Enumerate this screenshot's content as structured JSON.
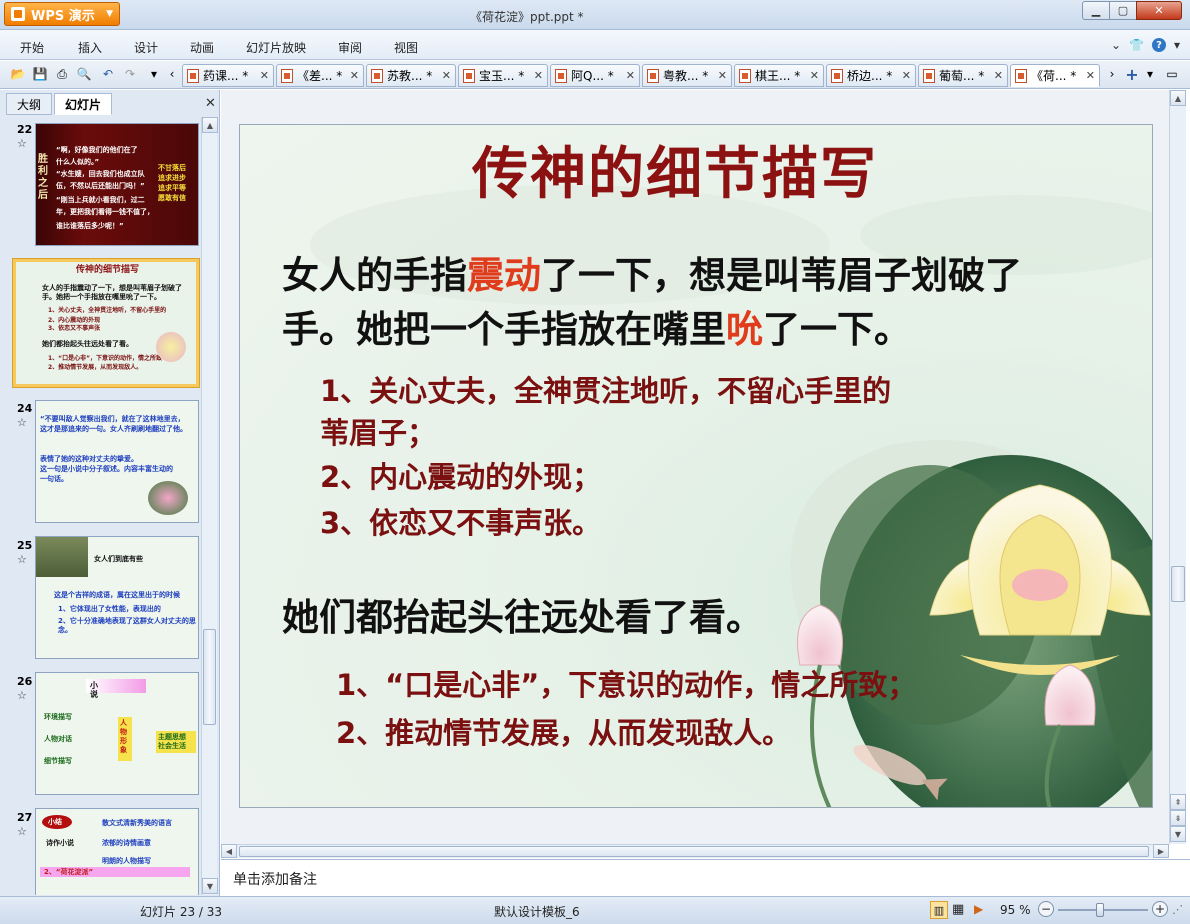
{
  "app": {
    "name": "WPS 演示",
    "window_title": "《荷花淀》ppt.ppt *"
  },
  "menu": [
    "开始",
    "插入",
    "设计",
    "动画",
    "幻灯片放映",
    "审阅",
    "视图"
  ],
  "tabs": [
    "药课... *",
    "《差... *",
    "苏教... *",
    "宝玉... *",
    "阿Q... *",
    "粤教... *",
    "棋王... *",
    "桥边... *",
    "葡萄... *",
    "《荷... *"
  ],
  "panel": {
    "tab_outline": "大纲",
    "tab_slides": "幻灯片"
  },
  "thumbnails": [
    {
      "num": "22",
      "lines": [
        "胜利之后",
        "“啊，好像我们的他们在了",
        "什么人似的。”",
        "“水生嫂，回去我们也成立队",
        "伍，不然以后还能出门吗！”",
        "“刚当上兵就小看我们，过二",
        "年，更把我们看得一钱不值了，",
        "谁比谁落后多少呢！”",
        "不甘落后",
        "追求进步",
        "追求平等",
        "愿敢有信"
      ]
    },
    {
      "num": "23",
      "lines": [
        "传神的细节描写",
        "女人的手指震动了一下，想是叫苇眉子划破了",
        "手。她把一个手指放在嘴里吮了一下。",
        "1、关心丈夫，全神贯注地听，不留心手里的",
        "2、内心震动的外现",
        "3、依恋又不事声张",
        "她们都抬起头往远处看了看。",
        "1、“口是心非”，下意识的动作，情之所致",
        "2、推动情节发展，从而发现敌人。"
      ]
    },
    {
      "num": "24",
      "lines": [
        "“不要叫敌人觉察出我们，就在了这林地里去，",
        "这才是那追来的一句。女人齐刷刷地翻过了他。",
        "表情了她的这种对丈夫的挚爱。",
        "这一句是小说中分子叙述。内容丰富生动的",
        "一句话。"
      ]
    },
    {
      "num": "25",
      "lines": [
        "女人们到底有些",
        "这是个吉祥的成语，属在这里出于的时候",
        "1、它体现出了女性能，表现出的",
        "2、它十分准确地表现了这群女人对丈夫的思念。"
      ]
    },
    {
      "num": "26",
      "lines": [
        "小说",
        "环境描写",
        "人物对话",
        "细节描写",
        "人物形象",
        "主题思想",
        "社会生活"
      ]
    },
    {
      "num": "27",
      "lines": [
        "小结",
        "散文式清新秀美的语言",
        "浓郁的诗情画意",
        "明朗的人物描写",
        "2、“荷花淀派”",
        "诗作小说"
      ]
    }
  ],
  "slide": {
    "title": "传神的细节描写",
    "p1_line1_a": "女人的手指",
    "p1_line1_hl": "震动",
    "p1_line1_b": "了一下，想是叫苇眉子划破了",
    "p1_line2_a": "手。她把一个手指放在嘴里",
    "p1_line2_hl": "吮",
    "p1_line2_b": "了一下。",
    "items1": [
      "1、关心丈夫，全神贯注地听，不留心手里的",
      "苇眉子；",
      "2、内心震动的外现；",
      "3、依恋又不事声张。"
    ],
    "p2": "她们都抬起头往远处看了看。",
    "items2": [
      "1、“口是心非”，下意识的动作，情之所致；",
      "2、推动情节发展，从而发现敌人。"
    ]
  },
  "notes_placeholder": "单击添加备注",
  "status": {
    "slide_counter": "幻灯片 23 / 33",
    "template": "默认设计模板_6",
    "zoom": "95 %"
  },
  "colors": {
    "title": "#8c1212",
    "highlight": "#e03c1c",
    "items": "#7a1010"
  }
}
